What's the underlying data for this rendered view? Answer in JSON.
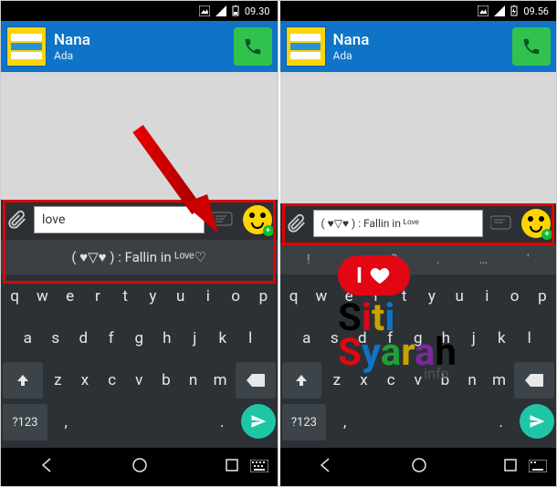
{
  "left": {
    "statusbar": {
      "time": "09.30"
    },
    "contact": {
      "name": "Nana",
      "status": "Ada"
    },
    "input_value": "love",
    "suggestion": "( ♥▽♥ ) : Fallin in ᴸᵒᵛᵉ♡"
  },
  "right": {
    "statusbar": {
      "time": "09.56"
    },
    "contact": {
      "name": "Nana",
      "status": "Ada"
    },
    "input_value": "( ♥▽♥ ) : Fallin in ᴸᵒᵛᵉ",
    "suggestion_punct": [
      "!",
      ",",
      "?",
      ".",
      "…",
      "'"
    ]
  },
  "keyboard": {
    "row1": [
      "q",
      "w",
      "e",
      "r",
      "t",
      "y",
      "u",
      "i",
      "o",
      "p"
    ],
    "row2": [
      "a",
      "s",
      "d",
      "f",
      "g",
      "h",
      "j",
      "k",
      "l"
    ],
    "row3_mid": [
      "z",
      "x",
      "c",
      "v",
      "b",
      "n",
      "m"
    ],
    "symkey": "?123",
    "comma": ",",
    "period": "."
  },
  "watermark": {
    "badge_text": "I",
    "line1": "Siti",
    "line2": "Syarah",
    "info": ".info"
  }
}
